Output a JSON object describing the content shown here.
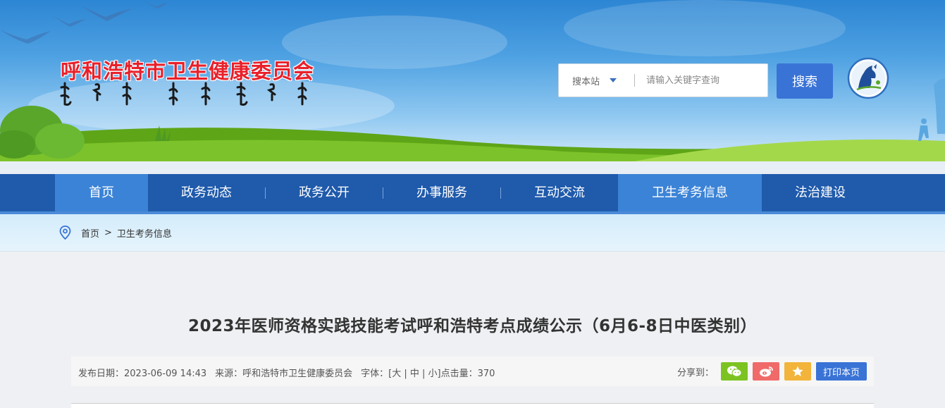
{
  "header": {
    "site_title": "呼和浩特市卫生健康委员会",
    "search": {
      "scope_label": "搜本站",
      "placeholder": "请输入关键字查询",
      "button_label": "搜索"
    }
  },
  "nav": {
    "items": [
      {
        "label": "首页",
        "active": true
      },
      {
        "label": "政务动态",
        "active": false
      },
      {
        "label": "政务公开",
        "active": false
      },
      {
        "label": "办事服务",
        "active": false
      },
      {
        "label": "互动交流",
        "active": false
      },
      {
        "label": "卫生考务信息",
        "active": true
      },
      {
        "label": "法治建设",
        "active": false
      }
    ]
  },
  "breadcrumb": {
    "home": "首页",
    "separator": ">",
    "current": "卫生考务信息"
  },
  "article": {
    "title": "2023年医师资格实践技能考试呼和浩特考点成绩公示（6月6-8日中医类别）",
    "meta": {
      "date": "发布日期：2023-06-09 14:43",
      "source": "来源：呼和浩特市卫生健康委员会",
      "font": "字体：[大 | 中 | 小]点击量：370"
    },
    "share": {
      "label": "分享到：",
      "print_label": "打印本页"
    }
  },
  "colors": {
    "nav_bg": "#1f5aab",
    "nav_active": "#3b83d6",
    "title_red": "#e8202a",
    "wechat": "#7cc322",
    "weibo": "#f06a6a",
    "favorite": "#f2b43a",
    "primary_button": "#3a73d6"
  }
}
